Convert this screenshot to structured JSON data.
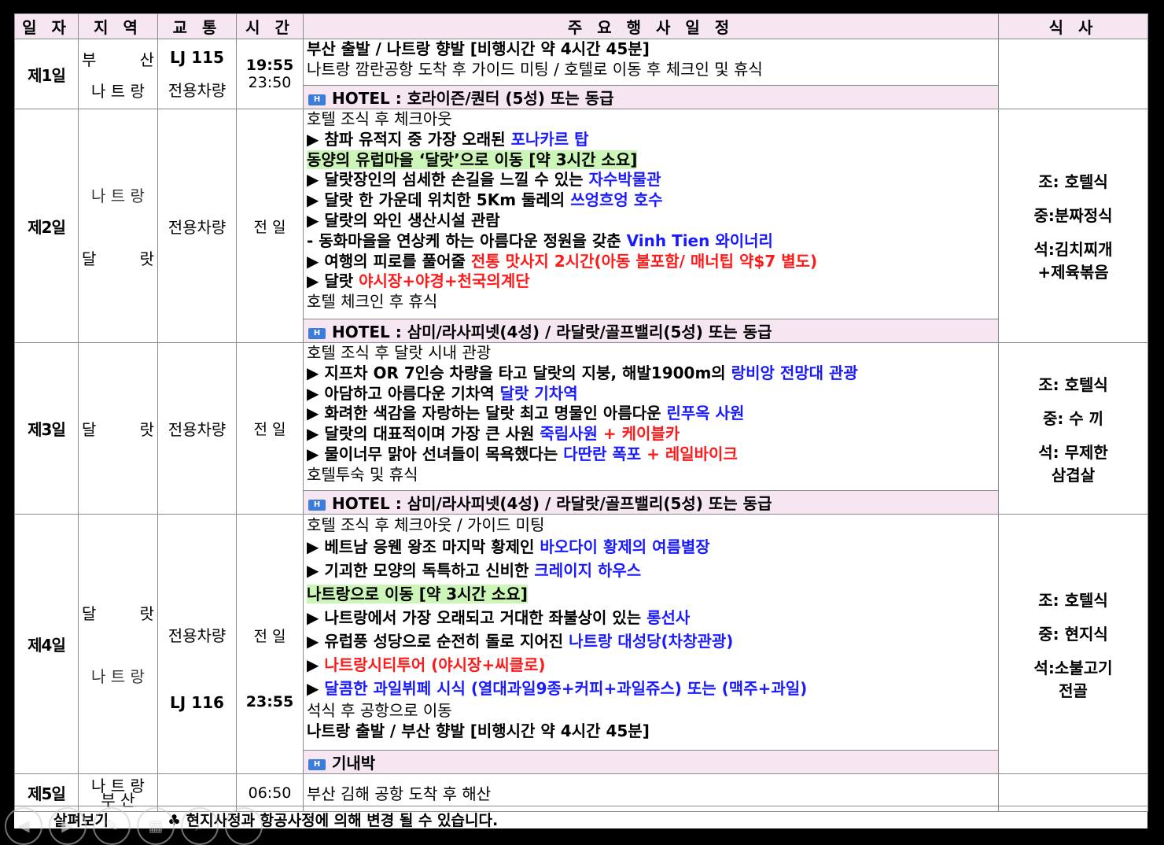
{
  "header": {
    "date": "일 자",
    "region": "지 역",
    "transport": "교 통",
    "time": "시 간",
    "schedule": "주 요 행 사 일 정",
    "meals": "식 사"
  },
  "days": [
    {
      "day": "제1일",
      "loc1a": "부",
      "loc1b": "산",
      "loc2": "나 트 랑",
      "trans1": "LJ 115",
      "trans2": "전용차량",
      "time1": "19:55",
      "time2": "23:50",
      "lines": [
        "부산 출발 / 나트랑 향발 [비행시간 약 4시간 45분]",
        "나트랑 깜란공항 도착 후 가이드 미팅 / 호텔로 이동 후 체크인 및 휴식"
      ],
      "hotel": "HOTEL : 호라이즌/퀀터 (5성) 또는 동급"
    },
    {
      "day": "제2일",
      "loc1": "나 트 랑",
      "loc2a": "달",
      "loc2b": "랏",
      "trans": "전용차량",
      "time": "전 일",
      "l1": "호텔 조식 후 체크아웃",
      "l2a": "▶ 참파 유적지 중 가장 오래된 ",
      "l2b": "포나카르 탑",
      "l3": "동양의 유럽마을 ‘달랏’으로 이동 [약 3시간 소요]",
      "l4a": "▶ 달랏장인의 섬세한 손길을 느낄 수 있는 ",
      "l4b": "자수박물관",
      "l5a": "▶ 달랏 한 가운데 위치한 5Km 둘레의 ",
      "l5b": "쓰엉흐엉 호수",
      "l6": "▶ 달랏의 와인 생산시설 관람",
      "l7a": "   - 동화마을을 연상케 하는 아름다운 정원을 갖춘 ",
      "l7b": "Vinh Tien 와이너리",
      "l8a": "▶ 여행의 피로를 풀어줄 ",
      "l8b": "전통 맛사지 2시간(아동 불포함/ 매너팁 약$7 별도)",
      "l9a": "▶ 달랏 ",
      "l9b": "야시장+야경+천국의계단",
      "l10": "호텔 체크인 후 휴식",
      "hotel": "HOTEL : 삼미/라사피넷(4성) / 라달랏/골프밸리(5성) 또는 동급",
      "meal1": "조: 호텔식",
      "meal2": "중:분짜정식",
      "meal3": "석:김치찌개",
      "meal4": "+제육볶음"
    },
    {
      "day": "제3일",
      "loc1": "달",
      "loc2": "랏",
      "trans": "전용차량",
      "time": "전 일",
      "l1": "호텔 조식 후 달랏 시내 관광",
      "l2a": "▶ 지프차 OR 7인승 차량을 타고 달랏의 지붕, 해발1900m의 ",
      "l2b": "랑비앙 전망대 관광",
      "l3a": "▶ 아담하고 아름다운 기차역 ",
      "l3b": "달랏 기차역",
      "l4a": "▶ 화려한 색감을 자랑하는 달랏 최고 명물인 아름다운 ",
      "l4b": "린푸옥 사원",
      "l5a": "▶ 달랏의 대표적이며 가장 큰 사원 ",
      "l5b": "죽림사원",
      "l5c": " + 케이블카",
      "l6a": "▶ 물이너무 맑아 선녀들이 목욕했다는 ",
      "l6b": "다딴란 폭포",
      "l6c": " + 레일바이크",
      "l7": "호텔투숙 및 휴식",
      "hotel": "HOTEL : 삼미/라사피넷(4성) / 라달랏/골프밸리(5성) 또는 동급",
      "meal1": "조: 호텔식",
      "meal2": "중: 수  끼",
      "meal3": "석: 무제한",
      "meal4": "삼겹살"
    },
    {
      "day": "제4일",
      "loc1a": "달",
      "loc1b": "랏",
      "loc2": "나 트 랑",
      "trans1": "전용차량",
      "trans2": "LJ 116",
      "time1": "전 일",
      "time2": "23:55",
      "l1": "호텔 조식 후 체크아웃 / 가이드 미팅",
      "l2a": "▶ 베트남 응웬 왕조 마지막 황제인 ",
      "l2b": "바오다이 황제의 여름별장",
      "l3a": "▶ 기괴한 모양의 독특하고 신비한 ",
      "l3b": "크레이지 하우스",
      "l4": "나트랑으로 이동 [약 3시간 소요]",
      "l5a": "▶ 나트랑에서 가장 오래되고 거대한 좌불상이 있는 ",
      "l5b": "롱선사",
      "l6a": "▶ 유럽풍 성당으로 순전히 돌로 지어진 ",
      "l6b": "나트랑 대성당(차창관광)",
      "l7a": "▶ ",
      "l7b": "나트랑시티투어 (야시장+씨클로)",
      "l8a": "▶ ",
      "l8b": "달콤한 과일뷔페 시식 (열대과일9종+커피+과일쥬스) 또는 (맥주+과일)",
      "l9": "석식 후 공항으로 이동",
      "l10": "나트랑 출발 / 부산 향발 [비행시간 약 4시간 45분]",
      "hotel": "기내박",
      "meal1": "조: 호텔식",
      "meal2": "중: 현지식",
      "meal3": "석:소불고기",
      "meal4": "전골"
    },
    {
      "day": "제5일",
      "loc1": "나 트 랑",
      "loc2": "부 산",
      "time": "06:50",
      "line": "부산 김해 공항 도착 후 해산"
    }
  ],
  "footer": {
    "label": "살펴보기",
    "note": "♣ 현지사정과 항공사정에 의해 변경 될 수 있습니다."
  },
  "hotel_icon": "H"
}
